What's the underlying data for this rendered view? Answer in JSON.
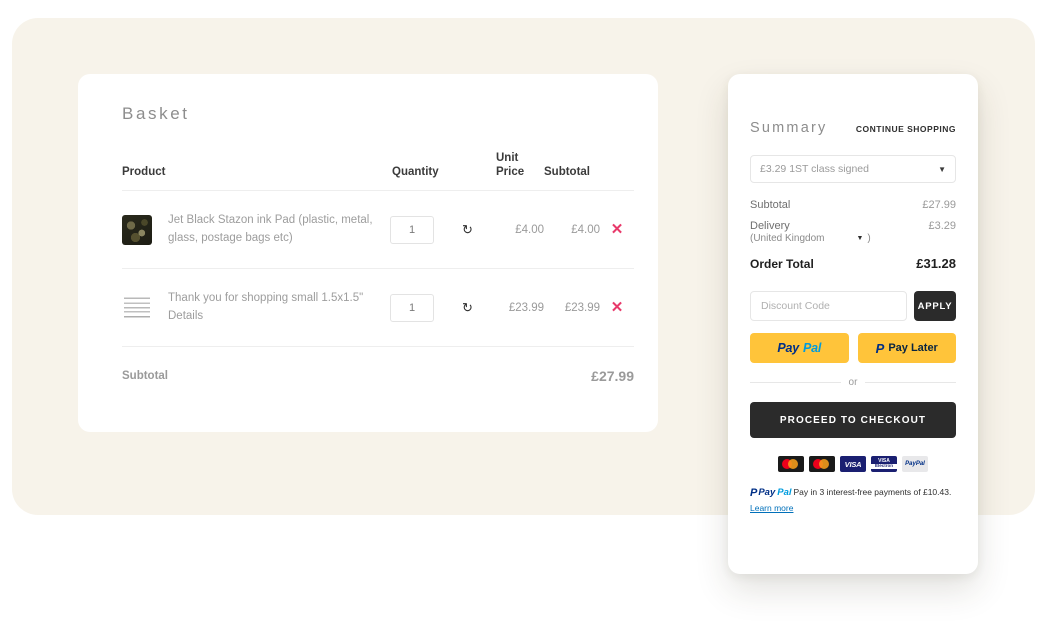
{
  "basket": {
    "title": "Basket",
    "columns": {
      "product": "Product",
      "quantity": "Quantity",
      "unit_price_line1": "Unit",
      "unit_price_line2": "Price",
      "subtotal": "Subtotal"
    },
    "rows": [
      {
        "name": "Jet Black Stazon ink Pad (plastic, metal, glass, postage bags etc)",
        "quantity": "1",
        "unit_price": "£4.00",
        "subtotal": "£4.00",
        "refresh_icon": "refresh-icon",
        "remove_icon": "close-icon"
      },
      {
        "name": "Thank you for shopping small 1.5x1.5\" Details",
        "quantity": "1",
        "unit_price": "£23.99",
        "subtotal": "£23.99",
        "refresh_icon": "refresh-icon",
        "remove_icon": "close-icon"
      }
    ],
    "footer": {
      "label": "Subtotal",
      "value": "£27.99"
    }
  },
  "summary": {
    "title": "Summary",
    "continue_shopping": "CONTINUE SHOPPING",
    "shipping_selected": "£3.29 1ST class signed",
    "subtotal_label": "Subtotal",
    "subtotal_value": "£27.99",
    "delivery_label": "Delivery",
    "delivery_value": "£3.29",
    "country_open": "(United Kingdom",
    "country_close": ")",
    "order_total_label": "Order Total",
    "order_total_value": "£31.28",
    "discount_placeholder": "Discount Code",
    "apply_label": "APPLY",
    "paypal_pay": "Pay",
    "paypal_pal": "Pal",
    "paypal_later": "Pay Later",
    "or_text": "or",
    "checkout_label": "PROCEED TO CHECKOUT",
    "cards": [
      {
        "name": "mastercard",
        "text": ""
      },
      {
        "name": "mastercard",
        "text": ""
      },
      {
        "name": "visa",
        "text": "VISA"
      },
      {
        "name": "visa-electron",
        "text": "VISA"
      },
      {
        "name": "paypal",
        "text": "PayPal"
      }
    ],
    "visa_electron_sub": "Electron",
    "payin3_text": "Pay in 3 interest-free payments of £10.43.",
    "payin3_link": "Learn more",
    "payin3_brand_pay": "Pay",
    "payin3_brand_pal": "Pal"
  },
  "colors": {
    "backdrop": "#f7f3ea",
    "card": "#ffffff",
    "dark_button": "#2b2b2b",
    "paypal_yellow": "#ffc43a",
    "remove_red": "#e8396a",
    "link_blue": "#0070ba"
  }
}
